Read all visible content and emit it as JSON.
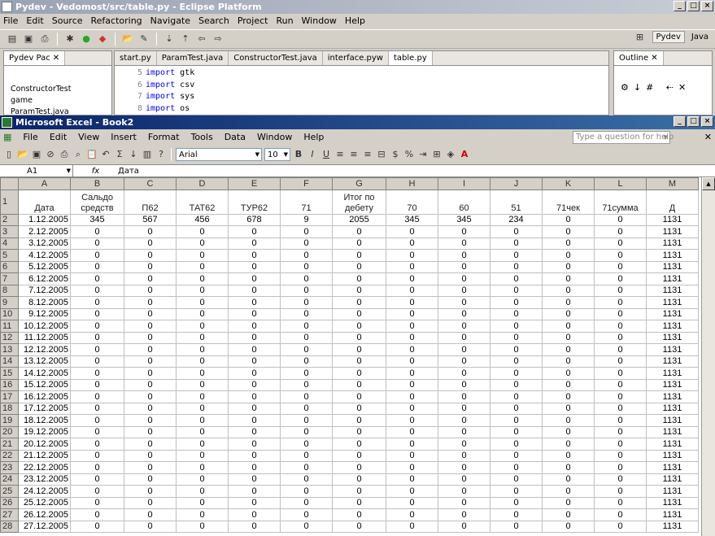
{
  "eclipse": {
    "title": "Pydev - Vedomost/src/table.py - Eclipse Platform",
    "menu": [
      "File",
      "Edit",
      "Source",
      "Refactoring",
      "Navigate",
      "Search",
      "Project",
      "Run",
      "Window",
      "Help"
    ],
    "perspectives": [
      "Pydev",
      "Java"
    ],
    "pkg_tab": "Pydev Pac",
    "tree": [
      "ConstructorTest",
      "game",
      "ParamTest.java"
    ],
    "editor_tabs": [
      "start.py",
      "ParamTest.java",
      "ConstructorTest.java",
      "interface.pyw",
      "table.py"
    ],
    "code": [
      {
        "ln": "5",
        "kw": "import",
        "mod": "gtk"
      },
      {
        "ln": "6",
        "kw": "import",
        "mod": "csv"
      },
      {
        "ln": "7",
        "kw": "import",
        "mod": "sys"
      },
      {
        "ln": "8",
        "kw": "import",
        "mod": "os"
      }
    ],
    "outline_tab": "Outline"
  },
  "excel": {
    "title": "Microsoft Excel - Book2",
    "menu": [
      "File",
      "Edit",
      "View",
      "Insert",
      "Format",
      "Tools",
      "Data",
      "Window",
      "Help"
    ],
    "help_placeholder": "Type a question for help",
    "font": "Arial",
    "size": "10",
    "name_box": "A1",
    "fx": "fx",
    "formula": "Дата",
    "columns": [
      "A",
      "B",
      "C",
      "D",
      "E",
      "F",
      "G",
      "H",
      "I",
      "J",
      "K",
      "L",
      "M"
    ],
    "header_row": [
      "Дата",
      "Сальдо средств",
      "П62",
      "ТАТ62",
      "ТУР62",
      "71",
      "Итог по дебету",
      "70",
      "60",
      "51",
      "71чек",
      "71сумма",
      "Д"
    ],
    "row2": [
      "1.12.2005",
      "345",
      "567",
      "456",
      "678",
      "9",
      "2055",
      "345",
      "345",
      "234",
      "0",
      "0",
      "1131"
    ],
    "dates": [
      "2.12.2005",
      "3.12.2005",
      "4.12.2005",
      "5.12.2005",
      "6.12.2005",
      "7.12.2005",
      "8.12.2005",
      "9.12.2005",
      "10.12.2005",
      "11.12.2005",
      "12.12.2005",
      "13.12.2005",
      "14.12.2005",
      "15.12.2005",
      "16.12.2005",
      "17.12.2005",
      "18.12.2005",
      "19.12.2005",
      "20.12.2005",
      "21.12.2005",
      "22.12.2005",
      "23.12.2005",
      "24.12.2005",
      "25.12.2005",
      "26.12.2005",
      "27.12.2005"
    ],
    "zero": "0",
    "last": "1131"
  }
}
